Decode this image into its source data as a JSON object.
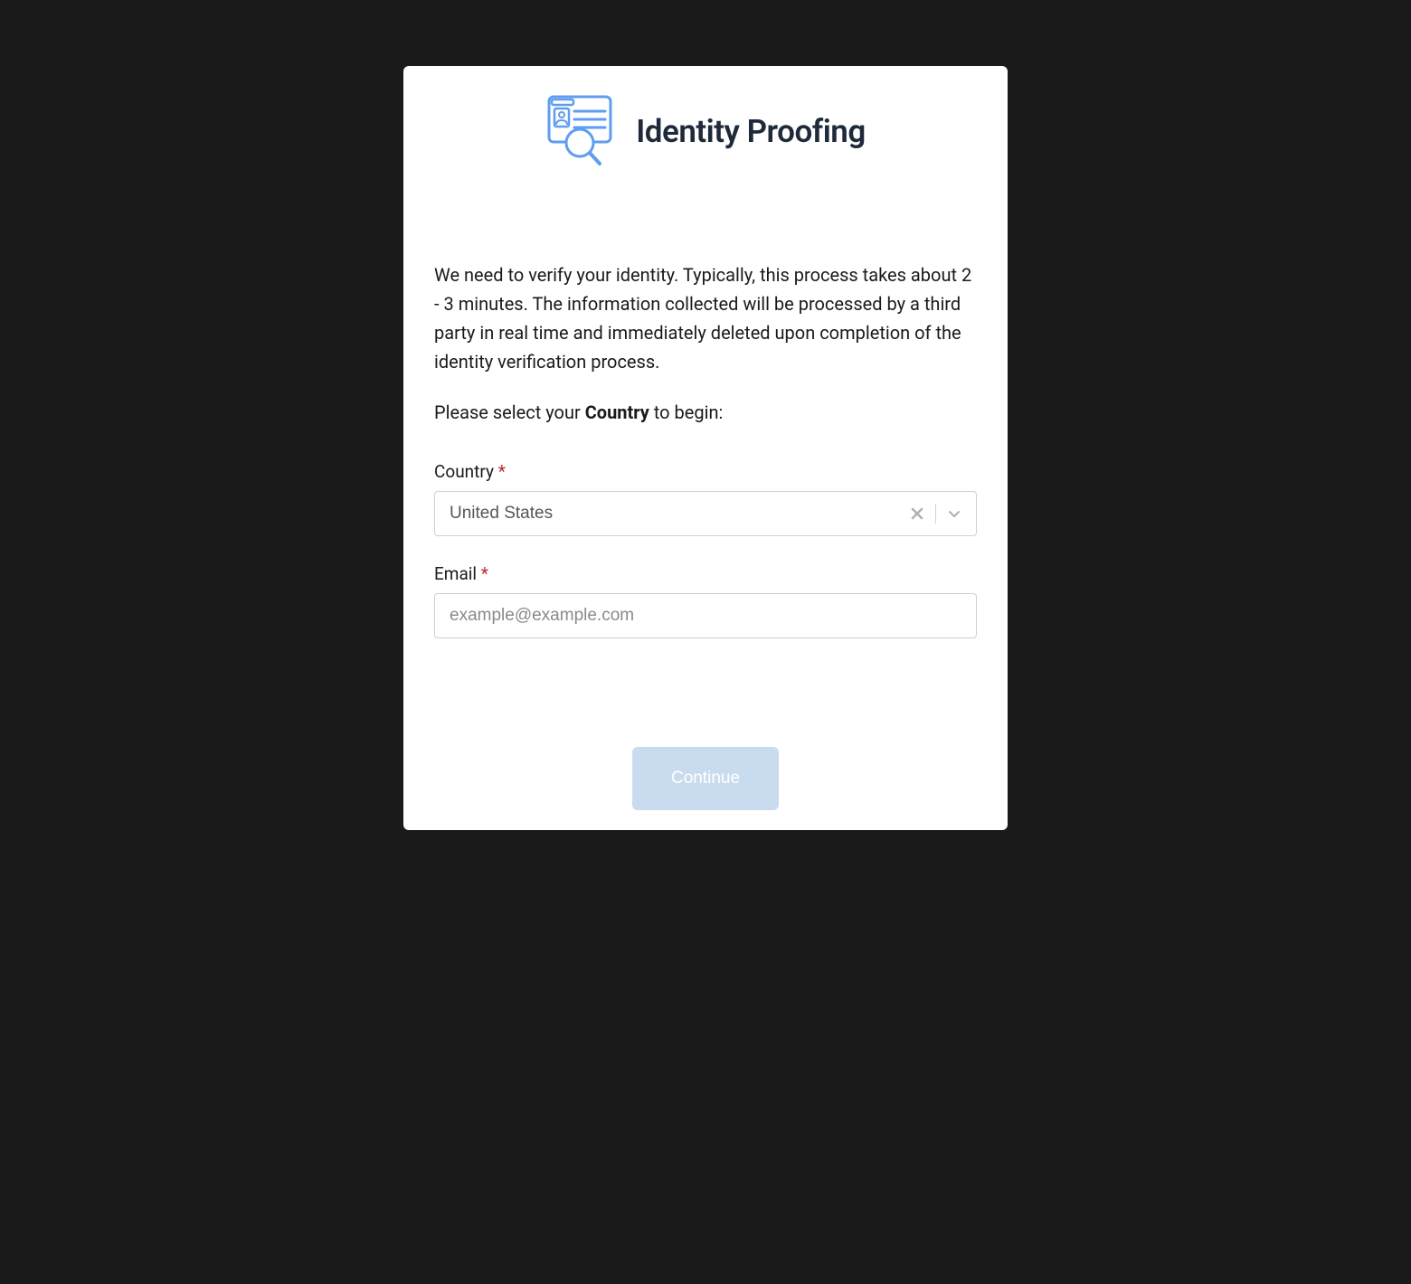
{
  "header": {
    "title": "Identity Proofing"
  },
  "content": {
    "description": "We need to verify your identity. Typically, this process takes about 2 - 3 minutes. The information collected will be processed by a third party in real time and immediately deleted upon completion of the identity verification process.",
    "instruction_prefix": "Please select your ",
    "instruction_bold": "Country",
    "instruction_suffix": " to begin:"
  },
  "form": {
    "country": {
      "label": "Country",
      "required_marker": "*",
      "value": "United States"
    },
    "email": {
      "label": "Email",
      "required_marker": "*",
      "placeholder": "example@example.com",
      "value": ""
    }
  },
  "actions": {
    "continue_label": "Continue"
  }
}
